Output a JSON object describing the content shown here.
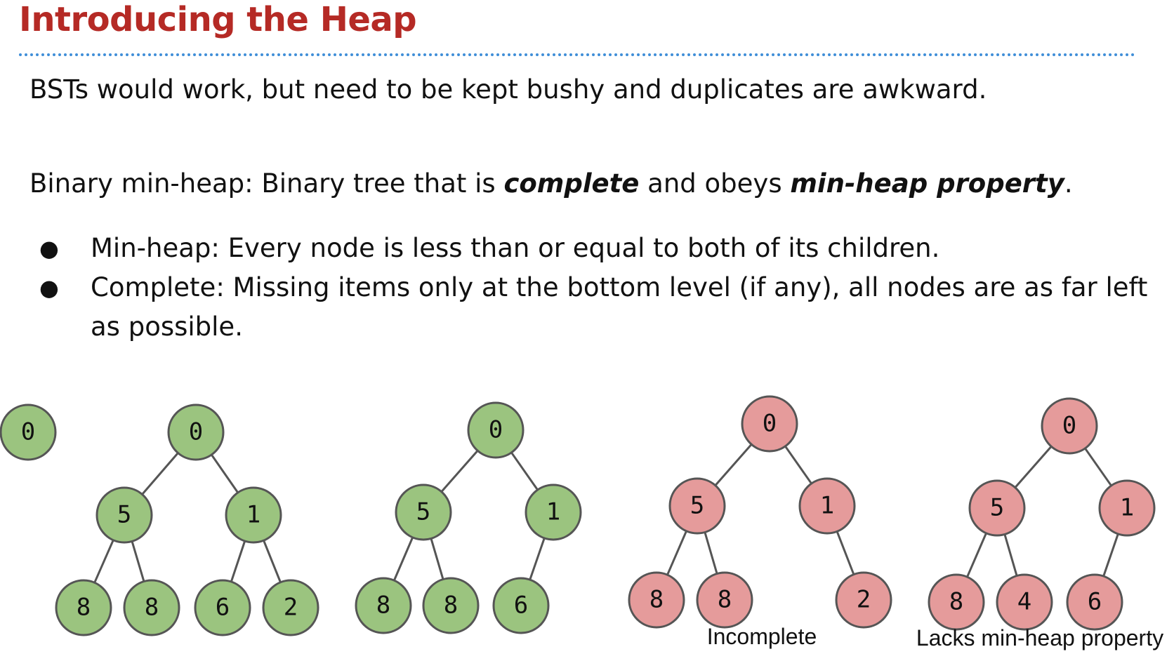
{
  "title": "Introducing the Heap",
  "intro": "BSTs would work, but need to be kept bushy and duplicates are awkward.",
  "definition": {
    "prefix": "Binary min-heap: Binary tree that is ",
    "term1": "complete",
    "middle": " and obeys ",
    "term2": "min-heap property",
    "suffix": "."
  },
  "bullets": [
    {
      "marker": "●",
      "text": "Min-heap: Every node is less than or equal to both of its children."
    },
    {
      "marker": "●",
      "text": "Complete: Missing items only at the bottom level (if any), all nodes are as far left as possible."
    }
  ],
  "colors": {
    "valid_fill": "#9bc47f",
    "invalid_fill": "#e59b9b",
    "node_stroke": "#555555",
    "edge": "#555555"
  },
  "trees": [
    {
      "status": "valid",
      "caption": "",
      "nodes": [
        {
          "id": "a",
          "label": "0"
        }
      ],
      "edges": []
    },
    {
      "status": "valid",
      "caption": "",
      "nodes": [
        {
          "id": "r",
          "label": "0"
        },
        {
          "id": "l",
          "label": "5"
        },
        {
          "id": "rr",
          "label": "1"
        },
        {
          "id": "ll",
          "label": "8"
        },
        {
          "id": "lr",
          "label": "8"
        },
        {
          "id": "rl",
          "label": "6"
        },
        {
          "id": "rrr",
          "label": "2"
        }
      ],
      "edges": [
        [
          "r",
          "l"
        ],
        [
          "r",
          "rr"
        ],
        [
          "l",
          "ll"
        ],
        [
          "l",
          "lr"
        ],
        [
          "rr",
          "rl"
        ],
        [
          "rr",
          "rrr"
        ]
      ]
    },
    {
      "status": "valid",
      "caption": "",
      "nodes": [
        {
          "id": "r",
          "label": "0"
        },
        {
          "id": "l",
          "label": "5"
        },
        {
          "id": "rr",
          "label": "1"
        },
        {
          "id": "ll",
          "label": "8"
        },
        {
          "id": "lr",
          "label": "8"
        },
        {
          "id": "rl",
          "label": "6"
        }
      ],
      "edges": [
        [
          "r",
          "l"
        ],
        [
          "r",
          "rr"
        ],
        [
          "l",
          "ll"
        ],
        [
          "l",
          "lr"
        ],
        [
          "rr",
          "rl"
        ]
      ]
    },
    {
      "status": "invalid",
      "caption": "Incomplete",
      "nodes": [
        {
          "id": "r",
          "label": "0"
        },
        {
          "id": "l",
          "label": "5"
        },
        {
          "id": "rr",
          "label": "1"
        },
        {
          "id": "ll",
          "label": "8"
        },
        {
          "id": "lr",
          "label": "8"
        },
        {
          "id": "rrr",
          "label": "2"
        }
      ],
      "edges": [
        [
          "r",
          "l"
        ],
        [
          "r",
          "rr"
        ],
        [
          "l",
          "ll"
        ],
        [
          "l",
          "lr"
        ],
        [
          "rr",
          "rrr"
        ]
      ]
    },
    {
      "status": "invalid",
      "caption": "Lacks min-heap property",
      "nodes": [
        {
          "id": "r",
          "label": "0"
        },
        {
          "id": "l",
          "label": "5"
        },
        {
          "id": "rr",
          "label": "1"
        },
        {
          "id": "ll",
          "label": "8"
        },
        {
          "id": "lr",
          "label": "4"
        },
        {
          "id": "rl",
          "label": "6"
        }
      ],
      "edges": [
        [
          "r",
          "l"
        ],
        [
          "r",
          "rr"
        ],
        [
          "l",
          "ll"
        ],
        [
          "l",
          "lr"
        ],
        [
          "rr",
          "rl"
        ]
      ]
    }
  ]
}
